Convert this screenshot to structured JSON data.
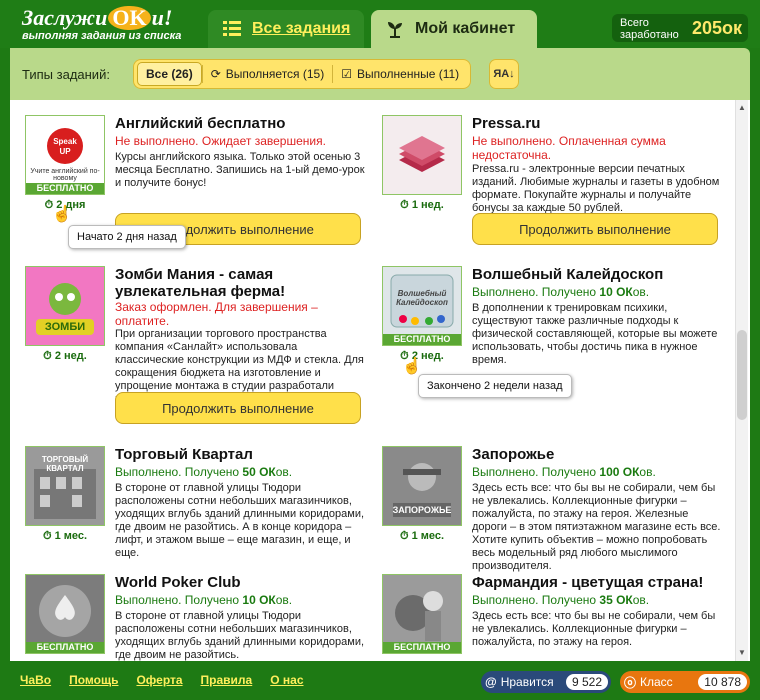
{
  "header": {
    "logo_title_a": "Заслужи",
    "logo_ok": "OK",
    "logo_title_b": "и!",
    "logo_sub": "выполняя задания из списка",
    "tab_all": "Все задания",
    "tab_cabinet": "Мой кабинет",
    "earned_label": "Всего заработано",
    "earned_value": "205ок"
  },
  "filter": {
    "label": "Типы заданий:",
    "all": "Все (26)",
    "in_progress": "Выполняется (15)",
    "done": "Выполненные (11)",
    "sort": "ЯA"
  },
  "cards": [
    {
      "title": "Английский бесплатно",
      "status": "Не выполнено. Ожидает завершения.",
      "desc": "Курсы английского языка. Только этой осенью 3 месяца Бесплатно. Запишись на 1-ый демо-урок и получите бонус!",
      "time": "2 дня",
      "button": "Продолжить выполнение",
      "badge": "БЕСПЛАТНО",
      "thumb_text": "Учите английский по-новому",
      "thumb_logo": "Speak UP",
      "tooltip": "Начато 2 дня назад"
    },
    {
      "title": "Pressa.ru",
      "status": "Не выполнено. Оплаченная сумма недостаточна.",
      "desc": "Pressa.ru - электронные версии печатных изданий. Любимые журналы и газеты в удобном формате. Покупайте журналы и получайте бонусы за каждые 50 рублей.",
      "time": "1 нед.",
      "button": "Продолжить выполнение"
    },
    {
      "title": "Зомби Мания - самая увлекательная ферма!",
      "status": "Заказ оформлен. Для завершения – оплатите.",
      "desc": "При организации торгового пространства компания «Санлайт» использовала классические конструкции из МДФ и стекла. Для сокращения бюджета на изготовление и упрощение монтажа в студии разработали комплект модулей.",
      "time": "2 нед.",
      "button": "Продолжить выполнение",
      "thumb_text": "ЗОМБИ"
    },
    {
      "title": "Волшебный Калейдоскоп",
      "status_prefix": "Выполнено. Получено ",
      "status_amount": "10 ОК",
      "status_suffix": "ов.",
      "desc": "В дополнении к тренировкам психики, существуют также различные подходы к физической составляющей, которые вы можете использовать, чтобы достичь пика в нужное время.",
      "time": "2 нед.",
      "badge": "БЕСПЛАТНО",
      "thumb_text": "Волшебный Калейдоскоп",
      "tooltip": "Закончено 2 недели назад"
    },
    {
      "title": "Торговый Квартал",
      "status_prefix": "Выполнено. Получено ",
      "status_amount": "50 ОК",
      "status_suffix": "ов.",
      "desc": "В стороне от главной улицы Тюдори расположены сотни небольших магазинчиков, уходящих вглубь зданий длинными коридорами, где двоим не разойтись. А в конце коридора – лифт, и этажом выше – еще магазин, и еще, и еще.",
      "time": "1 мес.",
      "thumb_text": "ТОРГОВЫЙ КВАРТАЛ"
    },
    {
      "title": "Запорожье",
      "status_prefix": "Выполнено. Получено ",
      "status_amount": "100 ОК",
      "status_suffix": "ов.",
      "desc": "Здесь есть все: что бы вы не собирали, чем бы не увлекались. Коллекционные фигурки – пожалуйста, по этажу на героя. Железные дороги – в этом пятиэтажном магазине есть все. Хотите купить объектив – можно попробовать весь модельный ряд любого мыслимого производителя.",
      "time": "1 мес.",
      "thumb_text": "ЗАПОРОЖЬЕ"
    },
    {
      "title": "World Poker Club",
      "status_prefix": "Выполнено. Получено ",
      "status_amount": "10 ОК",
      "status_suffix": "ов.",
      "desc": "В стороне от главной улицы Тюдори расположены сотни небольших магазинчиков, уходящих вглубь зданий длинными коридорами, где двоим не разойтись.",
      "badge": "БЕСПЛАТНО"
    },
    {
      "title": "Фармандия - цветущая страна!",
      "status_prefix": "Выполнено. Получено ",
      "status_amount": "35 ОК",
      "status_suffix": "ов.",
      "desc": "Здесь есть все: что бы вы не собирали, чем бы не увлекались. Коллекционные фигурки – пожалуйста, по этажу на героя.",
      "badge": "БЕСПЛАТНО"
    }
  ],
  "footer": {
    "links": [
      "ЧаВо",
      "Помощь",
      "Оферта",
      "Правила",
      "О нас"
    ],
    "likes_label": "Нравится",
    "likes_count": "9 522",
    "class_label": "Класс",
    "class_count": "10 878"
  },
  "colors": {
    "brand_green": "#1e7a14",
    "panel_green": "#b9d98a",
    "button_yellow": "#ffe04a",
    "status_red": "#d22222",
    "status_green": "#1a7a10"
  }
}
